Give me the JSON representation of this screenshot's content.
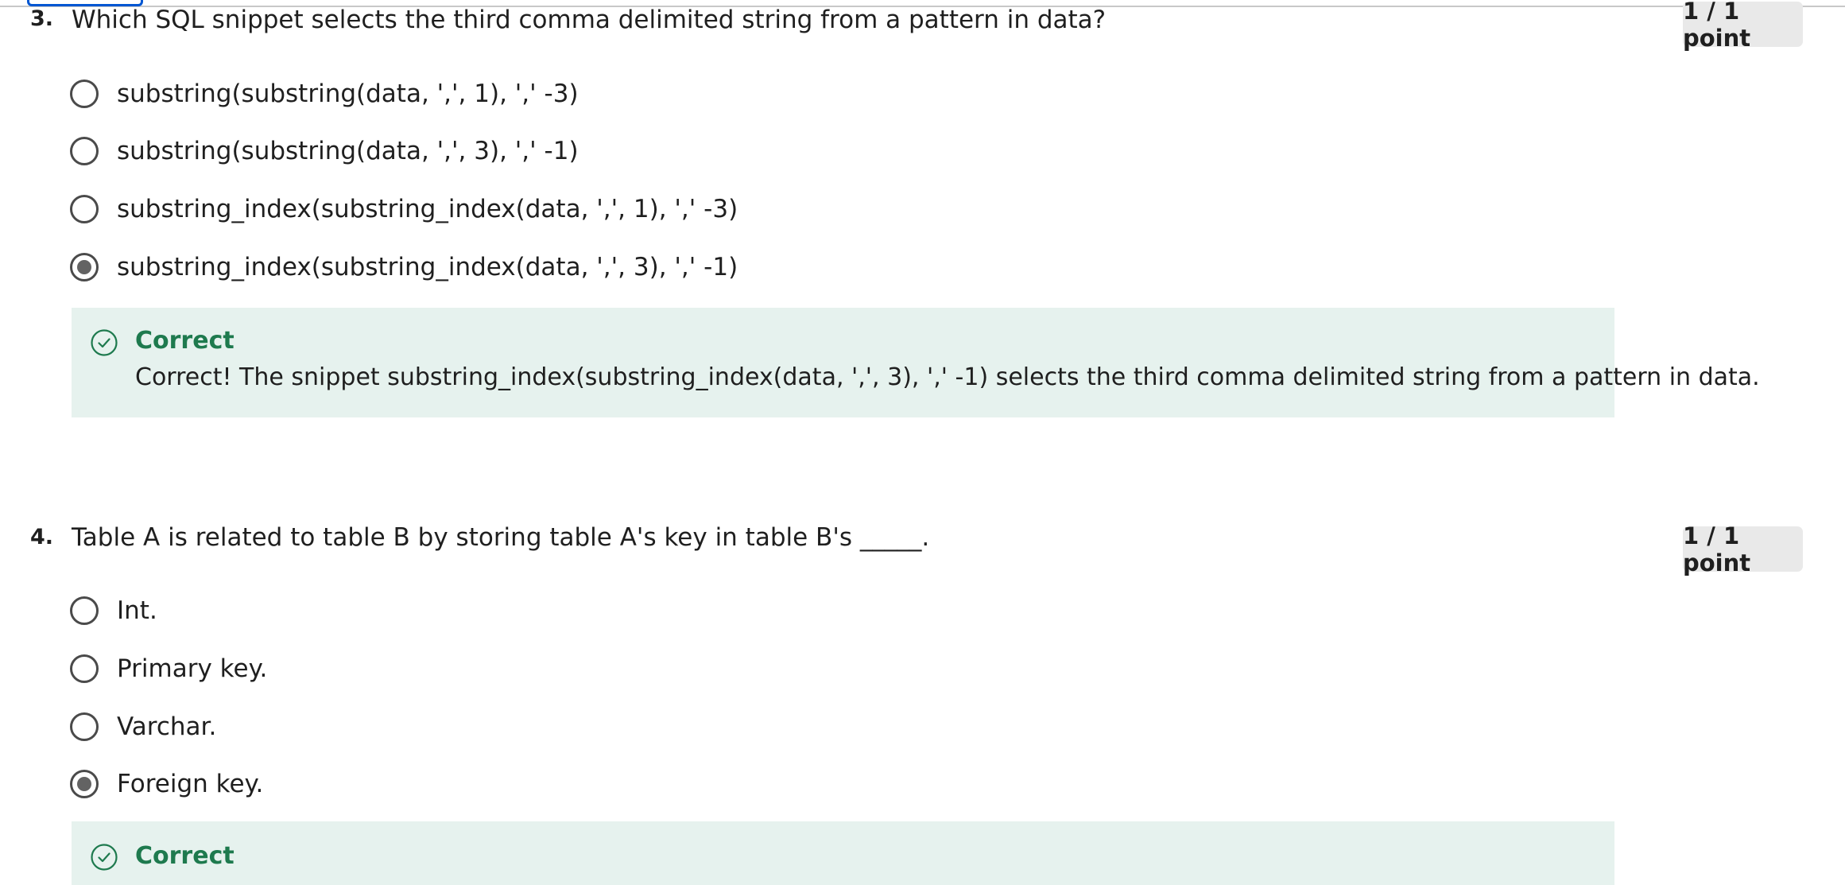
{
  "questions": [
    {
      "number": "3.",
      "text": "Which SQL snippet selects the third comma delimited string from a pattern in data?",
      "points": "1 / 1 point",
      "options": [
        {
          "label": "substring(substring(data, ',', 1), ',' -3)",
          "selected": false
        },
        {
          "label": "substring(substring(data, ',', 3), ',' -1)",
          "selected": false
        },
        {
          "label": "substring_index(substring_index(data, ',', 1), ',' -3)",
          "selected": false
        },
        {
          "label": "substring_index(substring_index(data, ',', 3), ',' -1)",
          "selected": true
        }
      ],
      "feedback": {
        "icon": "check-circle-icon",
        "title": "Correct",
        "text": "Correct! The snippet substring_index(substring_index(data, ',', 3), ',' -1) selects the third comma delimited string from a pattern in data."
      }
    },
    {
      "number": "4.",
      "text": "Table A is related to table B by storing table A's key in table B's _____.",
      "points": "1 / 1 point",
      "options": [
        {
          "label": "Int.",
          "selected": false
        },
        {
          "label": "Primary key.",
          "selected": false
        },
        {
          "label": "Varchar.",
          "selected": false
        },
        {
          "label": "Foreign key.",
          "selected": true
        }
      ],
      "feedback": {
        "icon": "check-circle-icon",
        "title": "Correct"
      }
    }
  ],
  "colors": {
    "correct_green": "#1e7a4e",
    "feedback_bg": "#e6f2ee",
    "points_bg": "#e9e9e9",
    "focus_blue": "#0056d2"
  }
}
